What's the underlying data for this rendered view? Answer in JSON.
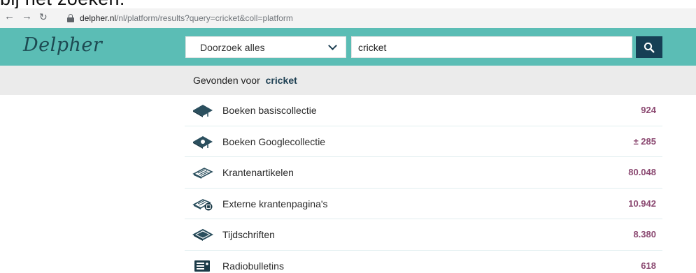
{
  "caption": "bij het zoeken.",
  "browser": {
    "url_host": "delpher.nl",
    "url_path": "/nl/platform/results?query=cricket&coll=platform"
  },
  "header": {
    "logo": "Delpher",
    "select_value": "Doorzoek alles",
    "search_value": "cricket"
  },
  "found": {
    "prefix": "Gevonden voor",
    "term": "cricket"
  },
  "results": [
    {
      "label": "Boeken basiscollectie",
      "count": "924",
      "icon": "book-icon"
    },
    {
      "label": "Boeken Googlecollectie",
      "count": "± 285",
      "icon": "google-book-icon"
    },
    {
      "label": "Krantenartikelen",
      "count": "80.048",
      "icon": "newspaper-icon"
    },
    {
      "label": "Externe krantenpagina's",
      "count": "10.942",
      "icon": "external-newspaper-icon"
    },
    {
      "label": "Tijdschriften",
      "count": "8.380",
      "icon": "magazine-icon"
    },
    {
      "label": "Radiobulletins",
      "count": "618",
      "icon": "radio-icon"
    }
  ],
  "colors": {
    "header": "#5bbdb5",
    "dark_blue": "#163f55",
    "count": "#8c4a72"
  }
}
